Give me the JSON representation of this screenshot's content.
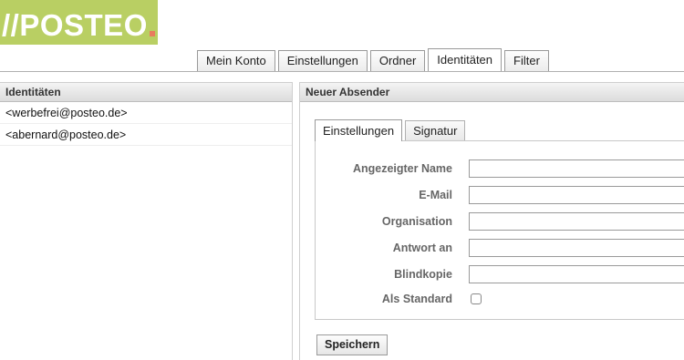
{
  "logo": {
    "text": "//POSTEO",
    "brand_color": "#b9cf63",
    "dot_color": "#e87d5f"
  },
  "top_tabs": [
    {
      "label": "Mein Konto",
      "active": false
    },
    {
      "label": "Einstellungen",
      "active": false
    },
    {
      "label": "Ordner",
      "active": false
    },
    {
      "label": "Identitäten",
      "active": true
    },
    {
      "label": "Filter",
      "active": false
    }
  ],
  "left_panel": {
    "header": "Identitäten",
    "items": [
      "<werbefrei@posteo.de>",
      "<abernard@posteo.de>"
    ]
  },
  "right_panel": {
    "header": "Neuer Absender",
    "tabs": [
      {
        "label": "Einstellungen",
        "active": true
      },
      {
        "label": "Signatur",
        "active": false
      }
    ],
    "fields": [
      {
        "label": "Angezeigter Name",
        "value": ""
      },
      {
        "label": "E-Mail",
        "value": ""
      },
      {
        "label": "Organisation",
        "value": ""
      },
      {
        "label": "Antwort an",
        "value": ""
      },
      {
        "label": "Blindkopie",
        "value": ""
      }
    ],
    "default_checkbox": {
      "label": "Als Standard",
      "checked": false
    },
    "save_label": "Speichern"
  }
}
